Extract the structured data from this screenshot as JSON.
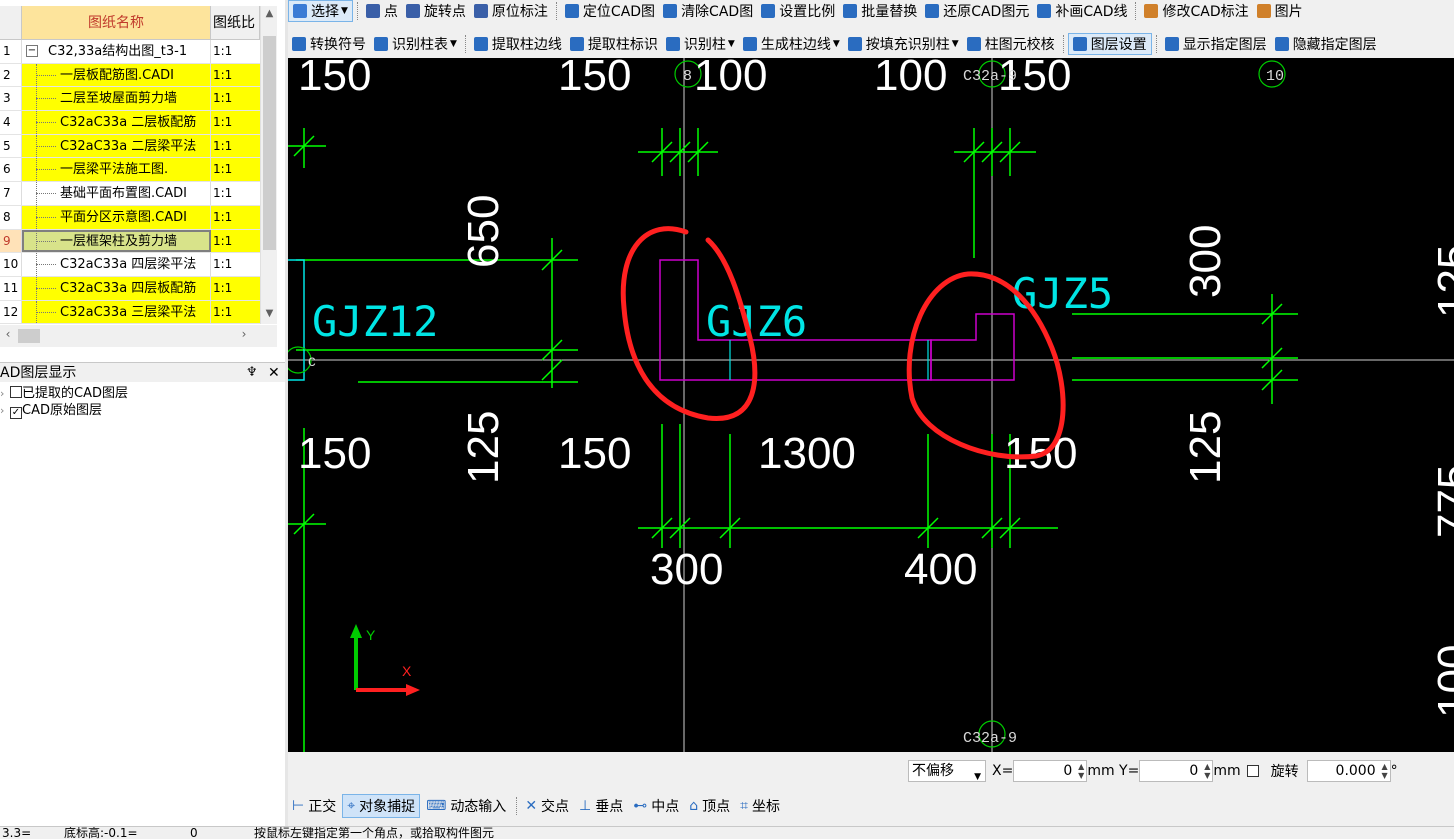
{
  "drawing_list": {
    "col_name": "图纸名称",
    "col_scale": "图纸比",
    "rows": [
      {
        "num": "1",
        "name": "C32,33a结构出图_t3-1",
        "scale": "1:1",
        "yellow": false,
        "root": true
      },
      {
        "num": "2",
        "name": "一层板配筋图.CADI",
        "scale": "1:1",
        "yellow": true
      },
      {
        "num": "3",
        "name": "二层至坡屋面剪力墙",
        "scale": "1:1",
        "yellow": true
      },
      {
        "num": "4",
        "name": "C32aC33a 二层板配筋",
        "scale": "1:1",
        "yellow": true
      },
      {
        "num": "5",
        "name": "C32aC33a 二层梁平法",
        "scale": "1:1",
        "yellow": true
      },
      {
        "num": "6",
        "name": "一层梁平法施工图.",
        "scale": "1:1",
        "yellow": true
      },
      {
        "num": "7",
        "name": "基础平面布置图.CADI",
        "scale": "1:1",
        "yellow": false
      },
      {
        "num": "8",
        "name": "平面分区示意图.CADI",
        "scale": "1:1",
        "yellow": true
      },
      {
        "num": "9",
        "name": "一层框架柱及剪力墙",
        "scale": "1:1",
        "yellow": true,
        "selected": true
      },
      {
        "num": "10",
        "name": "C32aC33a 四层梁平法",
        "scale": "1:1",
        "yellow": false
      },
      {
        "num": "11",
        "name": "C32aC33a 四层板配筋",
        "scale": "1:1",
        "yellow": true
      },
      {
        "num": "12",
        "name": "C32aC33a 三层梁平法",
        "scale": "1:1",
        "yellow": true
      }
    ]
  },
  "layer_panel": {
    "title": "AD图层显示",
    "pin": "♆",
    "close": "✕",
    "items": [
      {
        "label": "已提取的CAD图层",
        "checked": false
      },
      {
        "label": "CAD原始图层",
        "checked": true
      }
    ]
  },
  "toolbar1": [
    {
      "label": "选择",
      "dd": true,
      "active": true,
      "color": "#3a7bd5"
    },
    {
      "label": "点",
      "color": "#3a5fa8"
    },
    {
      "label": "旋转点",
      "color": "#3a5fa8"
    },
    {
      "label": "原位标注",
      "color": "#3a5fa8"
    },
    {
      "label": "定位CAD图",
      "color": "#2a6cc0"
    },
    {
      "label": "清除CAD图",
      "color": "#2a6cc0"
    },
    {
      "label": "设置比例",
      "color": "#2a6cc0"
    },
    {
      "label": "批量替换",
      "color": "#2a6cc0"
    },
    {
      "label": "还原CAD图元",
      "color": "#2a6cc0"
    },
    {
      "label": "补画CAD线",
      "color": "#2a6cc0"
    },
    {
      "label": "修改CAD标注",
      "color": "#d0802a"
    },
    {
      "label": "图片",
      "color": "#d0802a"
    }
  ],
  "toolbar2": [
    {
      "label": "转换符号",
      "color": "#2a6cc0"
    },
    {
      "label": "识别柱表",
      "dd": true,
      "color": "#2a6cc0"
    },
    {
      "label": "提取柱边线",
      "color": "#2a6cc0"
    },
    {
      "label": "提取柱标识",
      "color": "#2a6cc0"
    },
    {
      "label": "识别柱",
      "dd": true,
      "color": "#2a6cc0"
    },
    {
      "label": "生成柱边线",
      "dd": true,
      "color": "#2a6cc0"
    },
    {
      "label": "按填充识别柱",
      "dd": true,
      "color": "#2a6cc0"
    },
    {
      "label": "柱图元校核",
      "color": "#2a6cc0"
    },
    {
      "label": "图层设置",
      "active": true,
      "color": "#2a6cc0"
    },
    {
      "label": "显示指定图层",
      "color": "#2a6cc0"
    },
    {
      "label": "隐藏指定图层",
      "color": "#2a6cc0"
    }
  ],
  "canvas": {
    "dims": [
      "150",
      "150",
      "100",
      "100",
      "150",
      "650",
      "300",
      "125",
      "150",
      "125",
      "150",
      "1300",
      "150",
      "125",
      "300",
      "400"
    ],
    "col_labels": [
      "GJZ12",
      "GJZ6",
      "GJZ5"
    ],
    "axis_markers": [
      "8",
      "C32a-9",
      "10",
      "C",
      "C32a-9"
    ],
    "edge_fragments": [
      "125",
      "775",
      "100"
    ],
    "ucs_y": "Y",
    "ucs_x": "X"
  },
  "offset_bar": {
    "mode": "不偏移",
    "x_label": "X=",
    "x_value": "0",
    "y_label": "mm Y=",
    "y_value": "0",
    "mm": "mm",
    "rotate_label": "旋转",
    "rotate_value": "0.000",
    "degree": "°"
  },
  "snap_bar": [
    {
      "label": "正交",
      "on": false
    },
    {
      "label": "对象捕捉",
      "on": true
    },
    {
      "label": "动态输入",
      "on": false
    },
    {
      "label": "交点",
      "on": false
    },
    {
      "label": "垂点",
      "on": false
    },
    {
      "label": "中点",
      "on": false
    },
    {
      "label": "顶点",
      "on": false
    },
    {
      "label": "坐标",
      "on": false
    }
  ],
  "status_bar": {
    "s1": "3.3=",
    "s2": "底标高:-0.1=",
    "s3": "0",
    "s4": "按鼠标左键指定第一个角点，或拾取构件图元"
  },
  "colors": {
    "dim_green": "#00ff00",
    "label_cyan": "#00e5e5",
    "col_magenta": "#cc00cc",
    "annot_red": "#ff2020",
    "ucs_green": "#00cc00",
    "ucs_red": "#ff2020"
  }
}
